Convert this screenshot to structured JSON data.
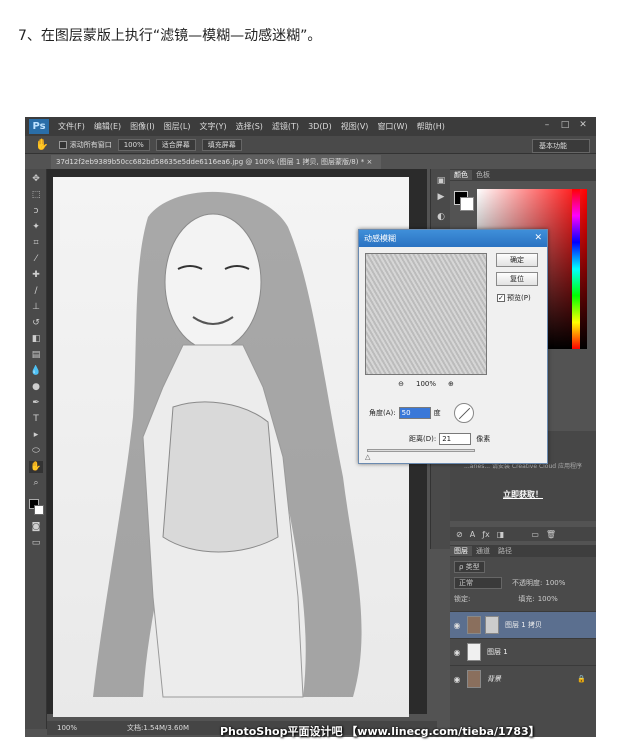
{
  "caption": "7、在图层蒙版上执行“滤镜—模糊—动感迷糊”。",
  "app": {
    "logo": "Ps",
    "menu": [
      "文件(F)",
      "编辑(E)",
      "图像(I)",
      "图层(L)",
      "文字(Y)",
      "选择(S)",
      "滤镜(T)",
      "3D(D)",
      "视图(V)",
      "窗口(W)",
      "帮助(H)"
    ]
  },
  "options": {
    "scroll_all": "滚动所有窗口",
    "btn_100": "100%",
    "fit_screen": "适合屏幕",
    "fill_screen": "填充屏幕",
    "workspace": "基本功能"
  },
  "document": {
    "tab": "37d12f2eb9389b50cc682bd58635e5dde6116ea6.jpg @ 100% (图层 1 拷贝, 图层蒙版/8) * ×"
  },
  "status": {
    "zoom": "100%",
    "doc": "文档:1.54M/3.60M"
  },
  "color_panel": {
    "tab1": "颜色",
    "tab2": "色板"
  },
  "learn": {
    "text": "...aries... 请安装 Creative Cloud 应用程序",
    "link": "立即获取！"
  },
  "layers_panel": {
    "tabs": [
      "图层",
      "通道",
      "路径"
    ],
    "kind": "ρ 类型",
    "blend": "正常",
    "opacity_label": "不透明度:",
    "opacity": "100%",
    "lock_label": "锁定:",
    "fill_label": "填充:",
    "fill": "100%",
    "layers": [
      {
        "name": "图层 1 拷贝"
      },
      {
        "name": "图层 1"
      },
      {
        "name": "背景"
      }
    ]
  },
  "dialog": {
    "title": "动感模糊",
    "ok": "确定",
    "reset": "复位",
    "preview": "预览(P)",
    "zoom": "100%",
    "angle_label": "角度(A):",
    "angle_value": "50",
    "angle_unit": "度",
    "distance_label": "距离(D):",
    "distance_value": "21",
    "distance_unit": "像素"
  },
  "watermark": "PhotoShop平面设计吧 【www.linecg.com/tieba/1783】"
}
